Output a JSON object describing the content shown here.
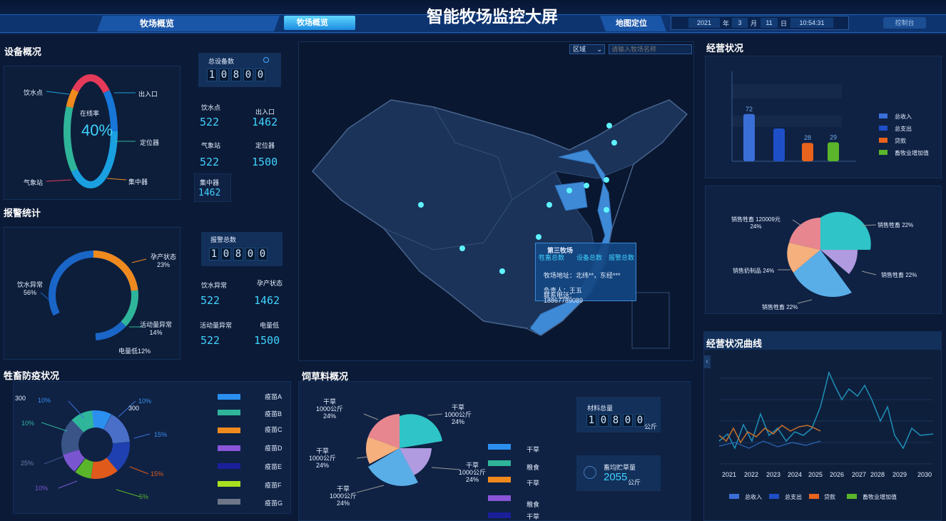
{
  "header": {
    "title": "智能牧场监控大屏",
    "nav_left_1": "牧场概览",
    "nav_left_2": "牧场概览",
    "nav_right_1": "地图定位",
    "year": "2021",
    "year_unit": "年",
    "month": "3",
    "month_unit": "月",
    "day": "11",
    "day_unit": "日",
    "time": "10:54:31",
    "control": "控制台"
  },
  "device": {
    "title": "设备概况",
    "center_label": "在线率",
    "center_value": "40%",
    "labels": [
      "饮水点",
      "出入口",
      "定位器",
      "集中器",
      "气象站"
    ],
    "total_label": "总设备数",
    "total_digits": [
      "1",
      "0",
      "8",
      "0",
      "0"
    ],
    "stats": [
      {
        "label": "饮水点",
        "value": "522"
      },
      {
        "label": "出入口",
        "value": "1462"
      },
      {
        "label": "气象站",
        "value": "522"
      },
      {
        "label": "定位器",
        "value": "1500"
      },
      {
        "label": "集中器",
        "value": "1462"
      }
    ]
  },
  "alarm": {
    "title": "报警统计",
    "labels": [
      {
        "name": "孕产状态",
        "pct": "23%"
      },
      {
        "name": "活动量异常",
        "pct": "14%"
      },
      {
        "name": "电量低12%",
        "pct": ""
      },
      {
        "name": "饮水异常",
        "pct": "56%"
      }
    ],
    "total_label": "报警总数",
    "total_digits": [
      "1",
      "0",
      "8",
      "0",
      "0"
    ],
    "stats": [
      {
        "label": "饮水异常",
        "value": "522"
      },
      {
        "label": "孕产状态",
        "value": "1462"
      },
      {
        "label": "活动量异常",
        "value": "522"
      },
      {
        "label": "电量低",
        "value": "1500"
      }
    ]
  },
  "epidemic": {
    "title": "牲畜防疫状况",
    "labels": [
      "300",
      "10%",
      "10%",
      "300",
      "15%",
      "15%",
      "5%",
      "10%",
      "25%",
      "10%"
    ],
    "legend": [
      {
        "name": "疫苗A",
        "color": "#2b8ff0"
      },
      {
        "name": "疫苗B",
        "color": "#2fb59a"
      },
      {
        "name": "疫苗C",
        "color": "#f08a1e"
      },
      {
        "name": "疫苗D",
        "color": "#8a55d8"
      },
      {
        "name": "疫苗E",
        "color": "#1a1f9a"
      },
      {
        "name": "疫苗F",
        "color": "#a8e020"
      },
      {
        "name": "疫苗G",
        "color": "#6e7688"
      }
    ]
  },
  "map": {
    "region_select": "区域",
    "search_placeholder": "请输入牧场名称",
    "popup": {
      "name": "第三牧场",
      "col1": "牲畜总数",
      "col2": "设备总数",
      "col3": "报警总数",
      "address": "牧场地址：北纬**，东经***",
      "manager": "负责人：王五",
      "phone_label": "联系电话：",
      "phone": "18867789089"
    }
  },
  "feed": {
    "title": "饲草料概况",
    "labels": [
      "干草\n1000公斤\n24%",
      "干草\n1000公斤\n24%",
      "干草\n1000公斤\n24%",
      "干草\n1000公斤\n24%",
      "干草\n1000公斤\n24%"
    ],
    "legend": [
      {
        "name": "干草",
        "color": "#2b8ff0"
      },
      {
        "name": "粮食",
        "color": "#2fb59a"
      },
      {
        "name": "干草",
        "color": "#f08a1e"
      },
      {
        "name": "粮食",
        "color": "#8a55d8"
      },
      {
        "name": "干草",
        "color": "#1a1f9a"
      }
    ],
    "material_label": "材料总量",
    "material_digits": [
      "1",
      "0",
      "8",
      "0",
      "0"
    ],
    "material_unit": "公斤",
    "storage_label": "畜均贮草量",
    "storage_value": "2055",
    "storage_unit": "公斤"
  },
  "business": {
    "title": "经营状况",
    "chart_data": {
      "type": "bar",
      "categories": [
        "总收入",
        "总支出",
        "贷款",
        "畜牧业增加值"
      ],
      "values": [
        72,
        50,
        28,
        29
      ],
      "value_labels": [
        "72",
        "",
        "28",
        "29"
      ],
      "colors": [
        "#3a6fd8",
        "#1f4fc8",
        "#e8631c",
        "#5ab52a"
      ]
    },
    "pie_labels": [
      "销售牲畜 120009元\n24%",
      "销售牲畜 22%",
      "销售奶制品 24%",
      "销售牲畜 22%",
      "销售牲畜 22%"
    ]
  },
  "curve": {
    "title": "经营状况曲线",
    "x_labels": [
      "2021",
      "2022",
      "2023",
      "2024",
      "2025",
      "2026",
      "2027",
      "2028",
      "2029",
      "2030"
    ],
    "legend": [
      {
        "name": "总收入",
        "color": "#3a6fd8"
      },
      {
        "name": "总支出",
        "color": "#1f4fc8"
      },
      {
        "name": "贷款",
        "color": "#e8631c"
      },
      {
        "name": "畜牧业增加值",
        "color": "#5ab52a"
      }
    ]
  }
}
